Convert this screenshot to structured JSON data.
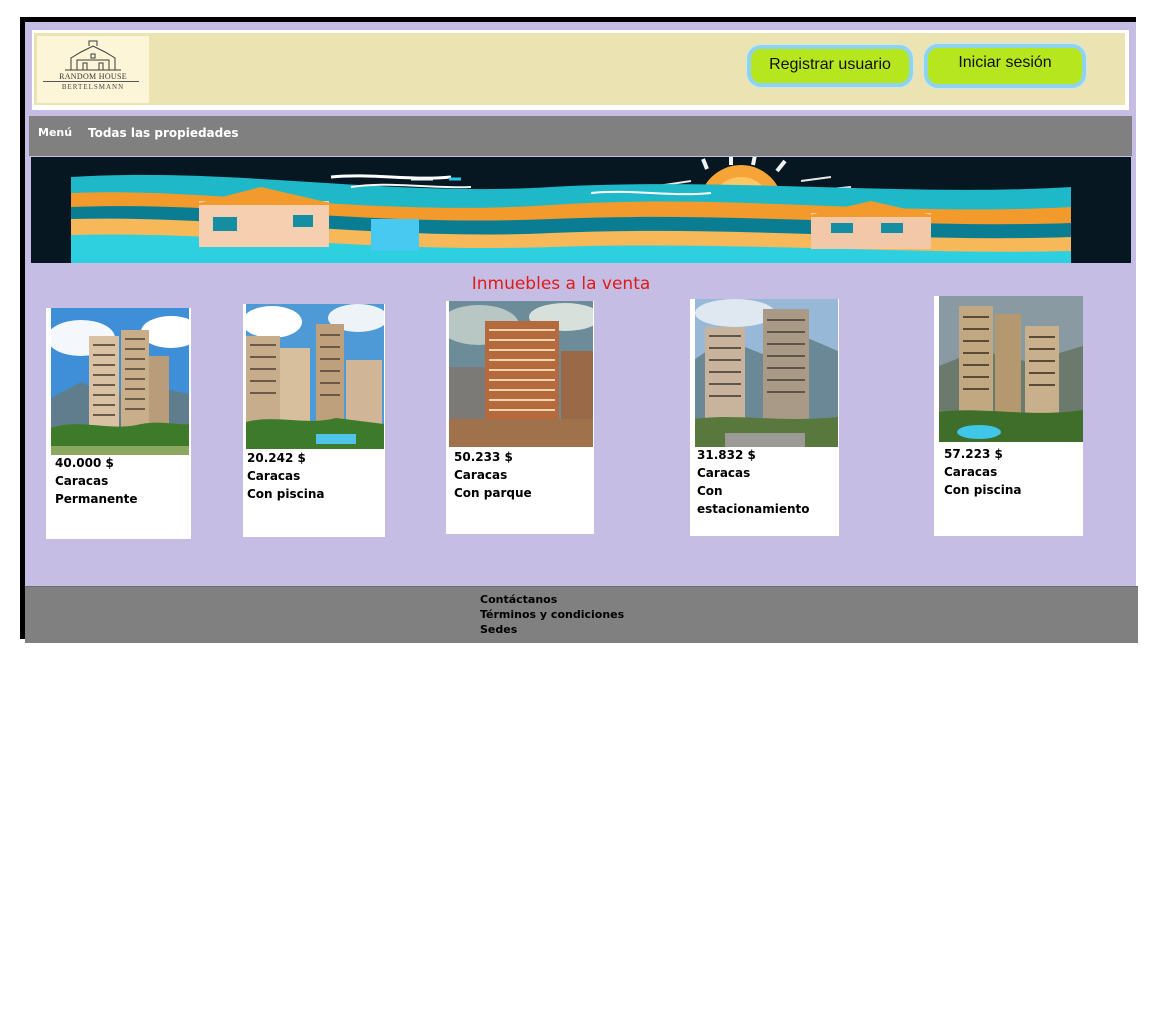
{
  "header": {
    "logo_line1": "RANDOM HOUSE",
    "logo_line2": "BERTELSMANN",
    "register_label": "Registrar usuario",
    "login_label": "Iniciar sesión"
  },
  "nav": {
    "menu_label": "Menú",
    "all_properties_label": "Todas las propiedades"
  },
  "main": {
    "section_title": "Inmuebles a la venta",
    "properties": [
      {
        "price": "40.000 $",
        "city": "Caracas",
        "feature": "Permanente"
      },
      {
        "price": "20.242 $",
        "city": "Caracas",
        "feature": "Con piscina"
      },
      {
        "price": "50.233 $",
        "city": "Caracas",
        "feature": "Con parque"
      },
      {
        "price": "31.832 $",
        "city": "Caracas",
        "feature": "Con estacionamiento"
      },
      {
        "price": "57.223 $",
        "city": "Caracas",
        "feature": "Con piscina"
      }
    ]
  },
  "footer": {
    "links": [
      "Contáctanos",
      "Términos y condiciones",
      "Sedes"
    ]
  },
  "colors": {
    "page_bg": "#c6bde4",
    "header_band": "#ece3b2",
    "nav_bg": "#808080",
    "button_fill": "#b6e61d",
    "button_border": "#8fd4ec",
    "title_red": "#e01a1a"
  }
}
